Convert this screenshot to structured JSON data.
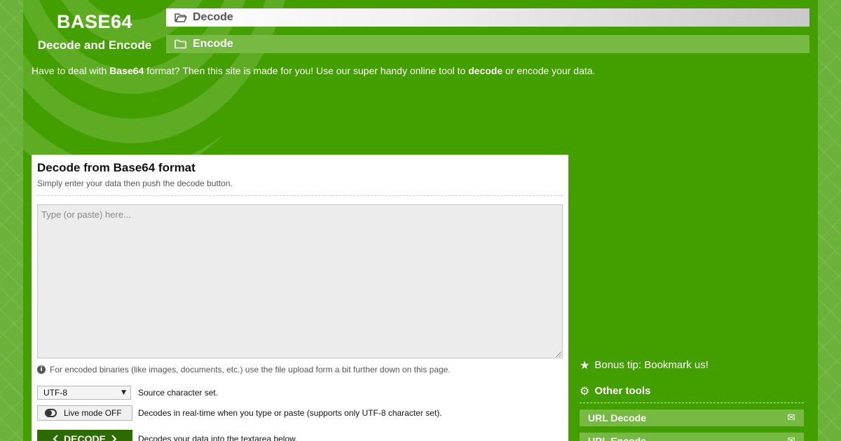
{
  "brand": {
    "title": "BASE64",
    "subtitle": "Decode and Encode"
  },
  "nav": {
    "decode": "Decode",
    "encode": "Encode"
  },
  "intro": {
    "part1": "Have to deal with ",
    "bold1": "Base64",
    "part2": " format? Then this site is made for you! Use our super handy online tool to ",
    "bold2": "decode",
    "part3": " or encode your data."
  },
  "main": {
    "title": "Decode from Base64 format",
    "subtitle": "Simply enter your data then push the decode button.",
    "textarea_placeholder": "Type (or paste) here...",
    "info_note": "For encoded binaries (like images, documents, etc.) use the file upload form a bit further down on this page.",
    "charset_value": "UTF-8",
    "charset_desc": "Source character set.",
    "live_mode_label": "Live mode OFF",
    "live_mode_desc": "Decodes in real-time when you type or paste (supports only UTF-8 character set).",
    "decode_button": "DECODE",
    "decode_desc": "Decodes your data into the textarea below."
  },
  "sidebar": {
    "bonus_tip": "Bonus tip: Bookmark us!",
    "other_tools_title": "Other tools",
    "tools": [
      {
        "label": "URL Decode"
      },
      {
        "label": "URL Encode"
      }
    ]
  },
  "colors": {
    "page_bg": "#439e00",
    "accent_dark": "#2d6b00",
    "nav_light": "#76b943"
  }
}
